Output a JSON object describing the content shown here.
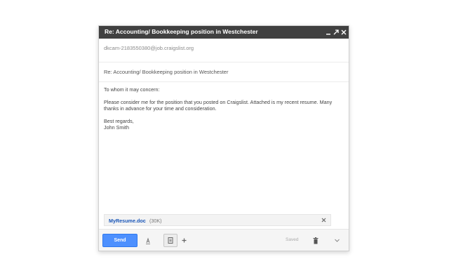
{
  "window": {
    "title": "Re: Accounting/ Bookkeeping position in Westchester"
  },
  "to": {
    "value": "dkcam-2183550380@job.craigslist.org"
  },
  "subject": {
    "value": "Re: Accounting/ Bookkeeping position in Westchester"
  },
  "message": {
    "greeting": "To whom it may concern:",
    "paragraph": "Please consider me for the position that you posted on Craigslist. Attached is my recent resume. Many thanks in advance for your time and consideration.",
    "closing": "Best regards,",
    "signature": "John Smith"
  },
  "attachment": {
    "name": "MyResume.doc",
    "size": "(30K)"
  },
  "toolbar": {
    "send_label": "Send",
    "saved_label": "Saved"
  },
  "colors": {
    "titlebar": "#404040",
    "send_button": "#4d90fe",
    "attachment_link": "#1a56b8"
  },
  "icons": [
    "minimize-icon",
    "popout-icon",
    "close-icon",
    "format-text-icon",
    "attach-file-icon",
    "insert-more-icon",
    "trash-icon",
    "more-options-icon",
    "remove-attachment-icon"
  ]
}
